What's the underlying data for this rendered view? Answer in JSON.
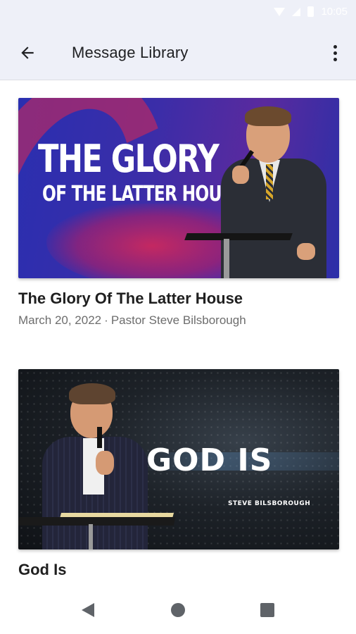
{
  "status_bar": {
    "time": "10:05",
    "icons": [
      "wifi-icon",
      "signal-icon",
      "battery-icon"
    ]
  },
  "app_bar": {
    "title": "Message Library",
    "back_icon": "arrow-back-icon",
    "menu_icon": "more-vert-icon"
  },
  "messages": [
    {
      "title": "The Glory Of The Latter House",
      "date": "March 20, 2022",
      "separator": "·",
      "speaker": "Pastor Steve Bilsborough",
      "artwork": {
        "line1": "THE GLORY",
        "line2": "OF THE LATTER HOUSE"
      }
    },
    {
      "title": "God Is",
      "date": "",
      "separator": "",
      "speaker": "",
      "artwork": {
        "line1": "GOD IS",
        "line2": "STEVE BILSBOROUGH"
      }
    }
  ],
  "nav_bar": {
    "buttons": [
      "back-triangle-icon",
      "home-circle-icon",
      "recents-square-icon"
    ]
  },
  "colors": {
    "app_bar_bg": "#eef0f8",
    "title_text": "#202124",
    "meta_text": "#6d6d6d",
    "nav_icon": "#5f6368"
  }
}
